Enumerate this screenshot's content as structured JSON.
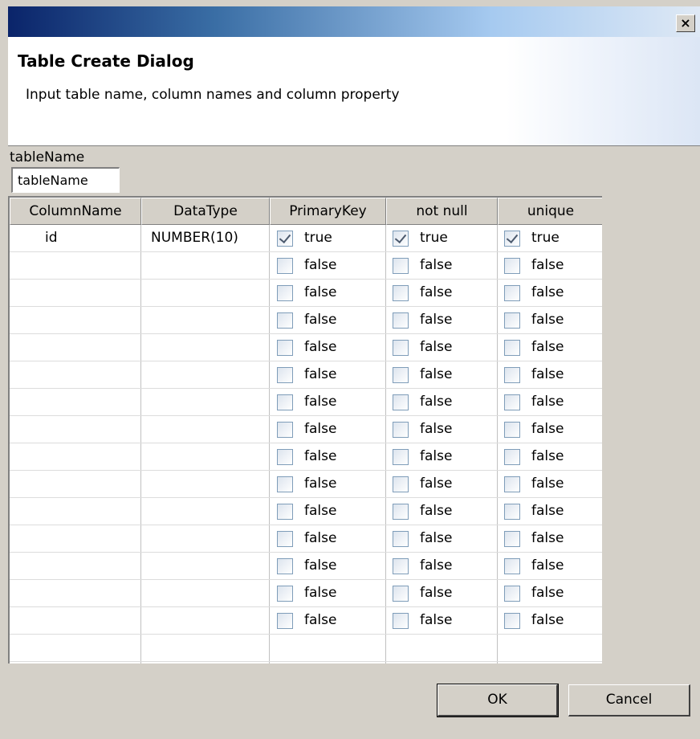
{
  "window": {
    "close_glyph": "×"
  },
  "header": {
    "title": "Table Create Dialog",
    "subtitle": "Input table name, column names and column property"
  },
  "table_name": {
    "label": "tableName",
    "value": "tableName"
  },
  "grid": {
    "columns": [
      "ColumnName",
      "DataType",
      "PrimaryKey",
      "not null",
      "unique"
    ],
    "rows": [
      {
        "name": "id",
        "type": "NUMBER(10)",
        "pk": "true",
        "nn": "true",
        "uq": "true"
      },
      {
        "name": "",
        "type": "",
        "pk": "false",
        "nn": "false",
        "uq": "false"
      },
      {
        "name": "",
        "type": "",
        "pk": "false",
        "nn": "false",
        "uq": "false"
      },
      {
        "name": "",
        "type": "",
        "pk": "false",
        "nn": "false",
        "uq": "false"
      },
      {
        "name": "",
        "type": "",
        "pk": "false",
        "nn": "false",
        "uq": "false"
      },
      {
        "name": "",
        "type": "",
        "pk": "false",
        "nn": "false",
        "uq": "false"
      },
      {
        "name": "",
        "type": "",
        "pk": "false",
        "nn": "false",
        "uq": "false"
      },
      {
        "name": "",
        "type": "",
        "pk": "false",
        "nn": "false",
        "uq": "false"
      },
      {
        "name": "",
        "type": "",
        "pk": "false",
        "nn": "false",
        "uq": "false"
      },
      {
        "name": "",
        "type": "",
        "pk": "false",
        "nn": "false",
        "uq": "false"
      },
      {
        "name": "",
        "type": "",
        "pk": "false",
        "nn": "false",
        "uq": "false"
      },
      {
        "name": "",
        "type": "",
        "pk": "false",
        "nn": "false",
        "uq": "false"
      },
      {
        "name": "",
        "type": "",
        "pk": "false",
        "nn": "false",
        "uq": "false"
      },
      {
        "name": "",
        "type": "",
        "pk": "false",
        "nn": "false",
        "uq": "false"
      },
      {
        "name": "",
        "type": "",
        "pk": "false",
        "nn": "false",
        "uq": "false"
      },
      {
        "name": "",
        "type": "",
        "pk": "",
        "nn": "",
        "uq": ""
      }
    ]
  },
  "buttons": {
    "ok": "OK",
    "cancel": "Cancel"
  }
}
